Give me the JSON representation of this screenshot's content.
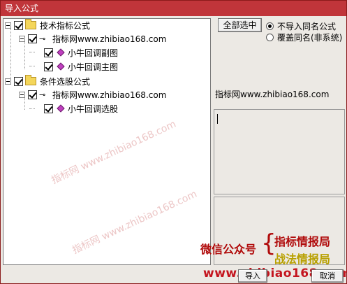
{
  "window": {
    "title": "导入公式"
  },
  "tree": [
    {
      "label": "技术指标公式"
    },
    {
      "label": "指标网www.zhibiao168.com"
    },
    {
      "label": "小牛回调副图"
    },
    {
      "label": "小牛回调主图"
    },
    {
      "label": "条件选股公式"
    },
    {
      "label": "指标网www.zhibiao168.com"
    },
    {
      "label": "小牛回调选股"
    }
  ],
  "select_all_label": "全部选中",
  "options": {
    "skip_label": "不导入同名公式",
    "overwrite_label": "覆盖同名(非系统)",
    "selected": "不导入同名公式"
  },
  "selected_name": "指标网www.zhibiao168.com",
  "promo": {
    "wechat": "微信公众号",
    "brace": "{",
    "line1": "指标情报局",
    "line2": "战法情报局",
    "url": "www.zhibiao168.com"
  },
  "buttons": {
    "import": "导入",
    "cancel": "取消"
  },
  "watermark": "指标网 www.zhibiao168.com",
  "colors": {
    "titlebar": "#c0353a",
    "promo_red": "#b00a0a",
    "promo_gold": "#b8a000"
  }
}
